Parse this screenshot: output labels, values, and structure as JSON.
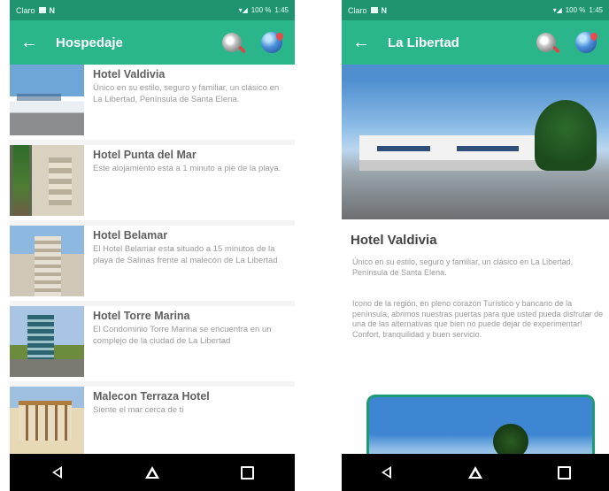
{
  "status_bar": {
    "carrier": "Claro",
    "n_label": "N",
    "battery": "100 %",
    "time": "1:45"
  },
  "left_screen": {
    "title": "Hospedaje",
    "hotels": [
      {
        "name": "Hotel Valdivia",
        "desc": "Único en su estilo, seguro y familiar, un clásico en La Libertad, Península de Santa Elena."
      },
      {
        "name": "Hotel Punta del Mar",
        "desc": "Este alojamiento está a 1 minuto a pie de la playa."
      },
      {
        "name": "Hotel Belamar",
        "desc": "El Hotel Belamar esta situado a 15 minutos de la playa de Salinas frente al malecón de La Libertad"
      },
      {
        "name": "Hotel Torre Marina",
        "desc": "El Condominio Torre Marina se encuentra en un complejo de la ciudad de La Libertad"
      },
      {
        "name": "Malecon Terraza Hotel",
        "desc": "Siente el mar cerca de ti"
      }
    ]
  },
  "right_screen": {
    "title": "La Libertad",
    "hotel_name": "Hotel Valdivia",
    "paragraph_1": "Único en su estilo, seguro y familiar, un clásico en La Libertad, Península de Santa Elena.",
    "paragraph_2": "Icono de la región, en pleno corazón Turístico y bancario de la península, abrimos nuestras puertas para que usted pueda disfrutar de una de las alternativas que bien no puede dejar de experimentar! Confort, tranquilidad y buen servicio."
  },
  "icons": {
    "back": "arrow-left-icon",
    "search": "search-icon",
    "globe": "globe-location-icon"
  },
  "colors": {
    "status_bar": "#20946f",
    "app_bar": "#2bb58b",
    "nav_bar": "#000000",
    "frame": "#1e9a74"
  }
}
